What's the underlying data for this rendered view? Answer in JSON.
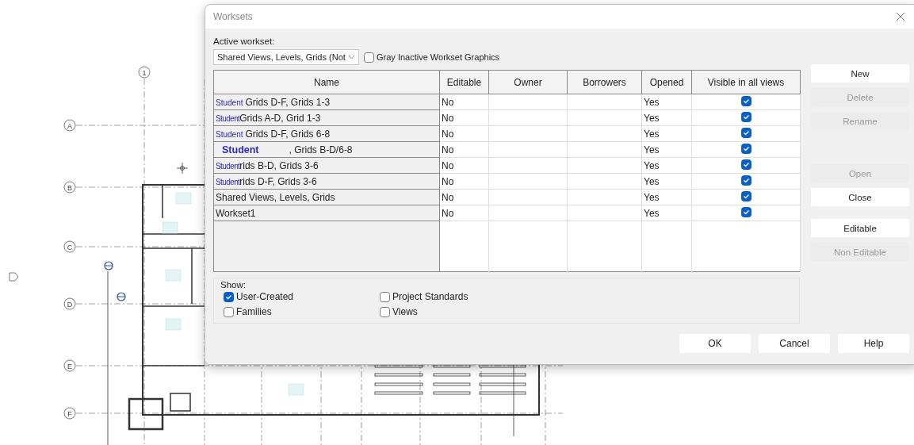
{
  "canvas": {
    "grid_rows": [
      "A",
      "B",
      "C",
      "D",
      "E",
      "F"
    ],
    "grid_columns": [
      "1"
    ]
  },
  "dialog": {
    "title": "Worksets",
    "active_workset_label": "Active workset:",
    "active_workset": "Shared Views, Levels, Grids (Not",
    "gray_inactive": {
      "label": "Gray Inactive Workset Graphics",
      "checked": false
    },
    "table": {
      "columns": [
        "Name",
        "Editable",
        "Owner",
        "Borrowers",
        "Opened",
        "Visible in all views"
      ],
      "rows": [
        {
          "tag": "Student",
          "kind": "spaced",
          "name": "Grids D-F, Grids 1-3",
          "editable": "No",
          "opened": "Yes",
          "visible": true
        },
        {
          "tag": "Student",
          "kind": "tight",
          "name": "Grids A-D, Grid 1-3",
          "editable": "No",
          "opened": "Yes",
          "visible": true
        },
        {
          "tag": "Student",
          "kind": "spaced",
          "name": "Grids D-F, Grids 6-8",
          "editable": "No",
          "opened": "Yes",
          "visible": true
        },
        {
          "tag": "Student",
          "kind": "large",
          "name": ", Grids B-D/6-8",
          "editable": "No",
          "opened": "Yes",
          "visible": true
        },
        {
          "tag": "Student",
          "kind": "tight",
          "name": "rids B-D, Grids 3-6",
          "editable": "No",
          "opened": "Yes",
          "visible": true
        },
        {
          "tag": "Student",
          "kind": "tight",
          "name": "rids D-F, Grids 3-6",
          "editable": "No",
          "opened": "Yes",
          "visible": true
        },
        {
          "name": "Shared Views, Levels, Grids",
          "editable": "No",
          "opened": "Yes",
          "visible": true
        },
        {
          "name": "Workset1",
          "editable": "No",
          "opened": "Yes",
          "visible": true
        }
      ]
    },
    "side_buttons": [
      {
        "label": "New",
        "disabled": false
      },
      {
        "label": "Delete",
        "disabled": true
      },
      {
        "label": "Rename",
        "disabled": true
      },
      {
        "label": "Open",
        "disabled": true
      },
      {
        "label": "Close",
        "disabled": false
      },
      {
        "label": "Editable",
        "disabled": false
      },
      {
        "label": "Non Editable",
        "disabled": true
      }
    ],
    "show": {
      "label": "Show:",
      "options": [
        {
          "label": "User-Created",
          "checked": true
        },
        {
          "label": "Project Standards",
          "checked": false
        },
        {
          "label": "Families",
          "checked": false
        },
        {
          "label": "Views",
          "checked": false
        }
      ]
    },
    "buttons": [
      "OK",
      "Cancel",
      "Help"
    ]
  }
}
